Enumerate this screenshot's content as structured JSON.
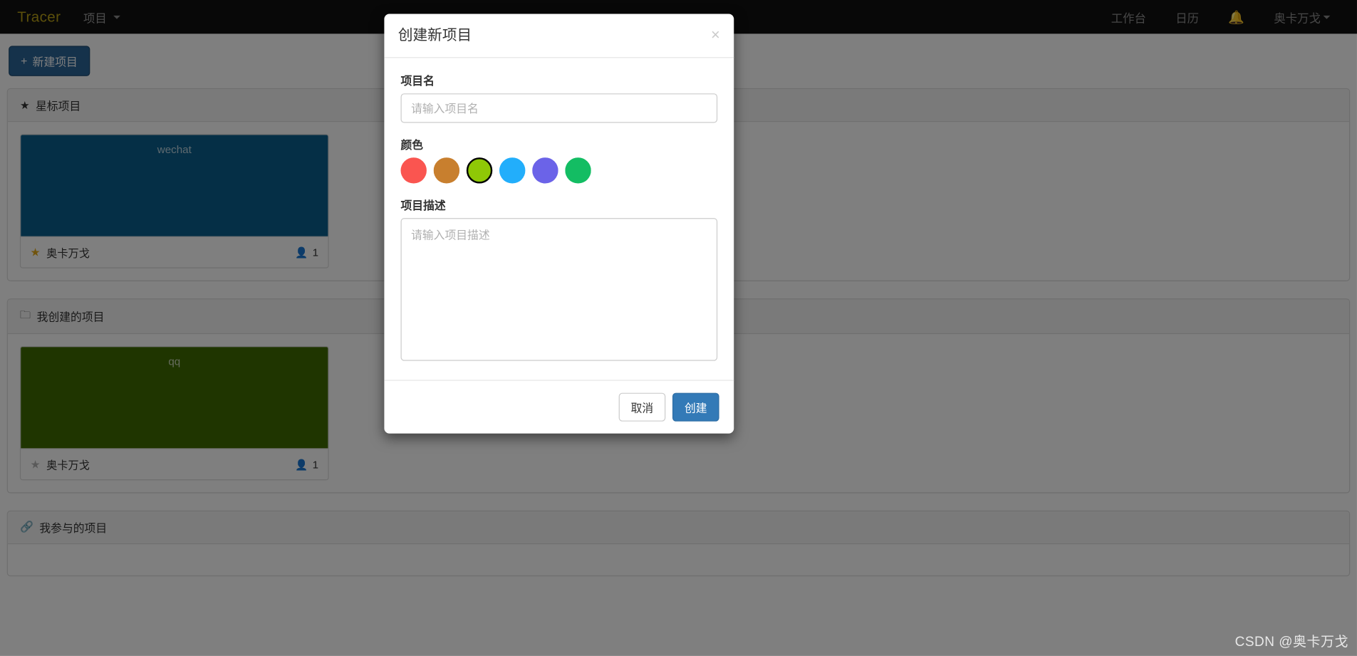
{
  "navbar": {
    "brand": "Tracer",
    "left_items": [
      {
        "label": "项目",
        "has_caret": true
      }
    ],
    "right_items": [
      {
        "label": "工作台",
        "icon": ""
      },
      {
        "label": "日历",
        "icon": ""
      },
      {
        "label": "",
        "icon": "bell-icon"
      },
      {
        "label": "奥卡万戈",
        "has_caret": true
      }
    ],
    "background": "#101010",
    "brand_color": "#b9a016"
  },
  "toolbar": {
    "new_project_label": "新建项目",
    "new_project_plus": "+"
  },
  "sections": [
    {
      "icon": "star-icon",
      "icon_glyph": "★",
      "title": "星标项目",
      "projects": [
        {
          "name": "wechat",
          "cover_color": "#0a5f8c",
          "starred": true,
          "star_glyph": "★",
          "owner": "奥卡万戈",
          "member_icon": "person-icon",
          "member_count": "1"
        }
      ]
    },
    {
      "icon": "folder-icon",
      "icon_glyph": "🗀",
      "title": "我创建的项目",
      "projects": [
        {
          "name": "qq",
          "cover_color": "#3f6b00",
          "starred": false,
          "star_glyph": "★",
          "owner": "奥卡万戈",
          "member_icon": "person-icon",
          "member_count": "1"
        }
      ]
    },
    {
      "icon": "link-icon",
      "icon_glyph": "🔗",
      "title": "我参与的项目",
      "projects": []
    }
  ],
  "modal": {
    "title": "创建新项目",
    "close_glyph": "×",
    "name_label": "项目名",
    "name_value": "",
    "name_placeholder": "请输入项目名",
    "color_label": "颜色",
    "colors": [
      {
        "hex": "#fa5550",
        "selected": false
      },
      {
        "hex": "#c87f2e",
        "selected": false
      },
      {
        "hex": "#8fc806",
        "selected": true
      },
      {
        "hex": "#22aefb",
        "selected": false
      },
      {
        "hex": "#6b63e8",
        "selected": false
      },
      {
        "hex": "#13bd63",
        "selected": false
      }
    ],
    "desc_label": "项目描述",
    "desc_value": "",
    "desc_placeholder": "请输入项目描述",
    "cancel_label": "取消",
    "create_label": "创建",
    "primary_color": "#337ab7"
  },
  "watermark": "CSDN @奥卡万戈"
}
